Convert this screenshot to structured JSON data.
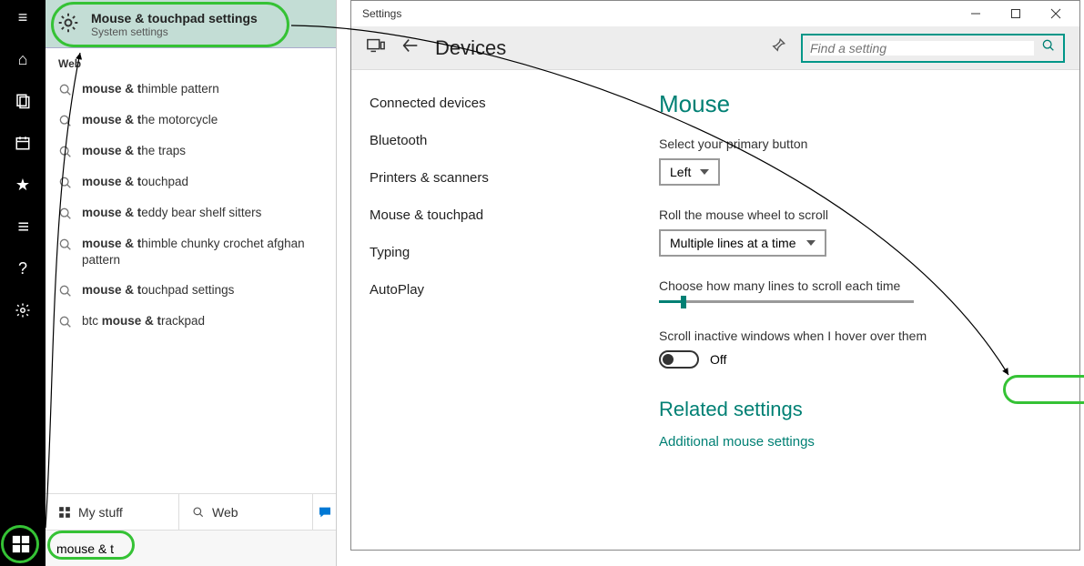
{
  "rail": {
    "icons": [
      "menu",
      "home",
      "recent",
      "calendar",
      "star",
      "list",
      "help",
      "settings"
    ]
  },
  "searchPanel": {
    "bestMatch": {
      "title": "Mouse & touchpad settings",
      "subtitle": "System settings"
    },
    "webLabel": "Web",
    "results": [
      {
        "pre": "mouse & t",
        "rest": "himble pattern"
      },
      {
        "pre": "mouse & t",
        "rest": "he motorcycle"
      },
      {
        "pre": "mouse & t",
        "rest": "he traps"
      },
      {
        "pre": "mouse & t",
        "rest": "ouchpad"
      },
      {
        "pre": "mouse & t",
        "rest": "eddy bear shelf sitters"
      },
      {
        "pre": "mouse & t",
        "rest": "himble chunky crochet afghan pattern"
      },
      {
        "pre": "mouse & t",
        "rest": "ouchpad settings"
      },
      {
        "preLight": "btc ",
        "pre": "mouse & t",
        "rest": "rackpad"
      }
    ],
    "tabs": {
      "myStuff": "My stuff",
      "web": "Web"
    },
    "query": "mouse & t"
  },
  "settingsWindow": {
    "title": "Settings",
    "headerTitle": "Devices",
    "searchPlaceholder": "Find a setting",
    "nav": [
      "Connected devices",
      "Bluetooth",
      "Printers & scanners",
      "Mouse & touchpad",
      "Typing",
      "AutoPlay"
    ],
    "content": {
      "h1": "Mouse",
      "primaryLabel": "Select your primary button",
      "primaryValue": "Left",
      "rollLabel": "Roll the mouse wheel to scroll",
      "rollValue": "Multiple lines at a time",
      "linesLabel": "Choose how many lines to scroll each time",
      "inactiveLabel": "Scroll inactive windows when I hover over them",
      "toggleText": "Off",
      "h2": "Related settings",
      "link": "Additional mouse settings"
    }
  }
}
